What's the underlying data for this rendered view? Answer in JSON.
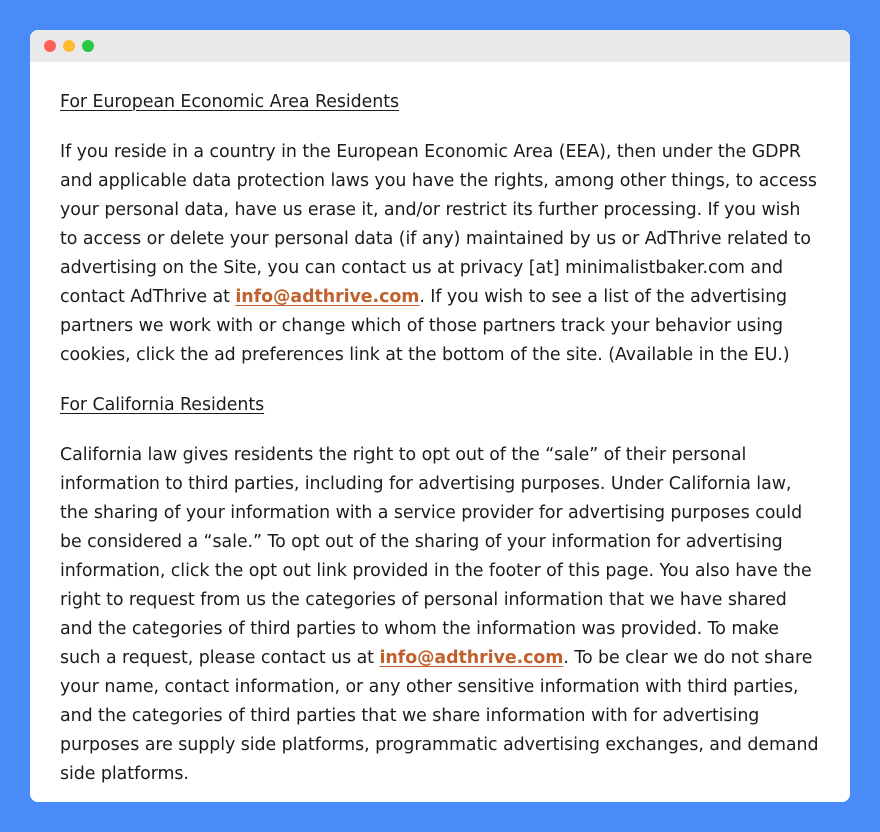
{
  "colors": {
    "background": "#4a8cf7",
    "window": "#ffffff",
    "titlebar": "#e9e9e9",
    "close": "#fe5f57",
    "minimize": "#febc2e",
    "zoom": "#28c840",
    "link": "#c0612d",
    "text": "#1c1c1c"
  },
  "window": {
    "controls": [
      "close-dot",
      "minimize-dot",
      "zoom-dot"
    ]
  },
  "eea": {
    "heading": "For European Economic Area Residents",
    "text_before_link": "If you reside in a country in the European Economic Area (EEA), then under the GDPR and applicable data protection laws you have the rights, among other things, to access your personal data, have us erase it, and/or restrict its further processing.  If you wish to access or delete your personal data (if any) maintained by us or AdThrive related to advertising on the Site, you can contact us at privacy [at] minimalistbaker.com and contact AdThrive at ",
    "link": "info@adthrive.com",
    "text_after_link": ". If you wish to see a list of the advertising partners we work with or change which of those partners track your behavior using cookies, click the ad preferences link at the bottom of the site. (Available in the EU.)"
  },
  "california": {
    "heading": "For California Residents",
    "text_before_link": "California law gives residents the right to opt out of the “sale” of their personal information to third parties, including for advertising purposes. Under California law, the sharing of your information with a service provider for advertising purposes could be considered a “sale.” To opt out of the sharing of your information for advertising information, click the opt out link provided in the footer of this page. You also have the right to request from us the categories of personal information that we have shared and the categories of third parties to whom the information was provided. To make such a request, please contact us at ",
    "link": "info@adthrive.com",
    "text_after_link": ". To be clear we do not share your name, contact information, or any other sensitive information with third parties, and the categories of third parties that we share information with for advertising purposes are supply side platforms, programmatic advertising exchanges, and demand side platforms."
  }
}
